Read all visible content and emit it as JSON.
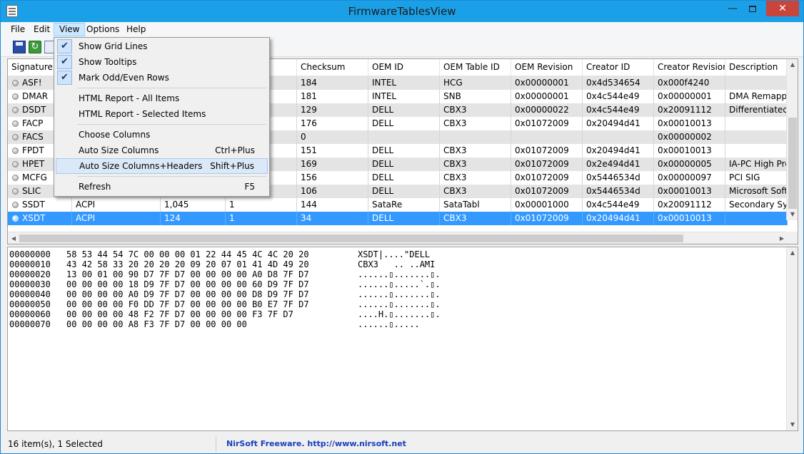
{
  "window": {
    "title": "FirmwareTablesView",
    "minimize_glyph": "—",
    "close_glyph": "✕"
  },
  "menubar": [
    {
      "label": "File"
    },
    {
      "label": "Edit"
    },
    {
      "label": "View"
    },
    {
      "label": "Options"
    },
    {
      "label": "Help"
    }
  ],
  "toolbar": {
    "refresh_glyph": "↻"
  },
  "view_menu": {
    "items": [
      {
        "label": "Show Grid Lines",
        "checked": true,
        "shortcut": ""
      },
      {
        "label": "Show Tooltips",
        "checked": true,
        "shortcut": ""
      },
      {
        "label": "Mark Odd/Even Rows",
        "checked": true,
        "shortcut": ""
      },
      {
        "label": "HTML Report - All Items",
        "checked": false,
        "shortcut": ""
      },
      {
        "label": "HTML Report - Selected Items",
        "checked": false,
        "shortcut": ""
      },
      {
        "label": "Choose Columns",
        "checked": false,
        "shortcut": ""
      },
      {
        "label": "Auto Size Columns",
        "checked": false,
        "shortcut": "Ctrl+Plus"
      },
      {
        "label": "Auto Size Columns+Headers",
        "checked": false,
        "shortcut": "Shift+Plus"
      },
      {
        "label": "Refresh",
        "checked": false,
        "shortcut": "F5"
      }
    ],
    "check_glyph": "✔"
  },
  "table": {
    "columns": [
      "Signature",
      "",
      "",
      "",
      "Checksum",
      "OEM ID",
      "OEM Table ID",
      "OEM Revision",
      "Creator ID",
      "Creator Revision",
      "Description"
    ],
    "rows": [
      [
        "ASF!",
        "",
        "",
        "",
        "184",
        "INTEL",
        "HCG",
        "0x00000001",
        "0x4d534654",
        "0x000f4240",
        ""
      ],
      [
        "DMAR",
        "",
        "",
        "",
        "181",
        "INTEL",
        "SNB",
        "0x00000001",
        "0x4c544e49",
        "0x00000001",
        "DMA Remappin"
      ],
      [
        "DSDT",
        "",
        "",
        "",
        "129",
        "DELL",
        "CBX3",
        "0x00000022",
        "0x4c544e49",
        "0x20091112",
        "Differentiated S"
      ],
      [
        "FACP",
        "",
        "",
        "",
        "176",
        "DELL",
        "CBX3",
        "0x01072009",
        "0x20494d41",
        "0x00010013",
        ""
      ],
      [
        "FACS",
        "",
        "",
        "",
        "0",
        "",
        "",
        "",
        "",
        "0x00000002",
        ""
      ],
      [
        "FPDT",
        "",
        "",
        "",
        "151",
        "DELL",
        "CBX3",
        "0x01072009",
        "0x20494d41",
        "0x00010013",
        ""
      ],
      [
        "HPET",
        "",
        "",
        "",
        "169",
        "DELL",
        "CBX3",
        "0x01072009",
        "0x2e494d41",
        "0x00000005",
        "IA-PC High Pre"
      ],
      [
        "MCFG",
        "",
        "",
        "",
        "156",
        "DELL",
        "CBX3",
        "0x01072009",
        "0x5446534d",
        "0x00000097",
        "PCI SIG"
      ],
      [
        "SLIC",
        "",
        "",
        "",
        "106",
        "DELL",
        "CBX3",
        "0x01072009",
        "0x5446534d",
        "0x00010013",
        "Microsoft Softw"
      ],
      [
        "SSDT",
        "ACPI",
        "1,045",
        "1",
        "144",
        "SataRe",
        "SataTabl",
        "0x00001000",
        "0x4c544e49",
        "0x20091112",
        "Secondary Syste"
      ],
      [
        "XSDT",
        "ACPI",
        "124",
        "1",
        "34",
        "DELL",
        "CBX3",
        "0x01072009",
        "0x20494d41",
        "0x00010013",
        ""
      ]
    ],
    "selected_row": 10,
    "scroll_up_glyph": "▲",
    "scroll_down_glyph": "▼",
    "scroll_left_glyph": "◀",
    "scroll_right_glyph": "▶"
  },
  "hex_dump": [
    {
      "offset": "00000000",
      "bytes": "58 53 44 54 7C 00 00 00 01 22 44 45 4C 4C 20 20",
      "ascii": "XSDT|....\"DELL"
    },
    {
      "offset": "00000010",
      "bytes": "43 42 58 33 20 20 20 20 09 20 07 01 41 4D 49 20",
      "ascii": "CBX3   .. ..AMI"
    },
    {
      "offset": "00000020",
      "bytes": "13 00 01 00 90 D7 7F D7 00 00 00 00 A0 D8 7F D7",
      "ascii": "......▯.......▯."
    },
    {
      "offset": "00000030",
      "bytes": "00 00 00 00 18 D9 7F D7 00 00 00 00 60 D9 7F D7",
      "ascii": "......▯.....`.▯."
    },
    {
      "offset": "00000040",
      "bytes": "00 00 00 00 A0 D9 7F D7 00 00 00 00 D8 D9 7F D7",
      "ascii": "......▯.......▯."
    },
    {
      "offset": "00000050",
      "bytes": "00 00 00 00 F0 DD 7F D7 00 00 00 00 B0 E7 7F D7",
      "ascii": "......▯.......▯."
    },
    {
      "offset": "00000060",
      "bytes": "00 00 00 00 48 F2 7F D7 00 00 00 00 F3 7F D7",
      "ascii": "....H.▯.......▯."
    },
    {
      "offset": "00000070",
      "bytes": "00 00 00 00 A8 F3 7F D7 00 00 00 00",
      "ascii": "......▯....."
    }
  ],
  "statusbar": {
    "count_text": "16 item(s), 1 Selected",
    "link_text": "NirSoft Freeware.  http://www.nirsoft.net"
  },
  "colors": {
    "titlebar": "#1ba0e8",
    "selection": "#3399ff",
    "alt_row": "#e4e4e4",
    "link": "#1a3fbd"
  }
}
